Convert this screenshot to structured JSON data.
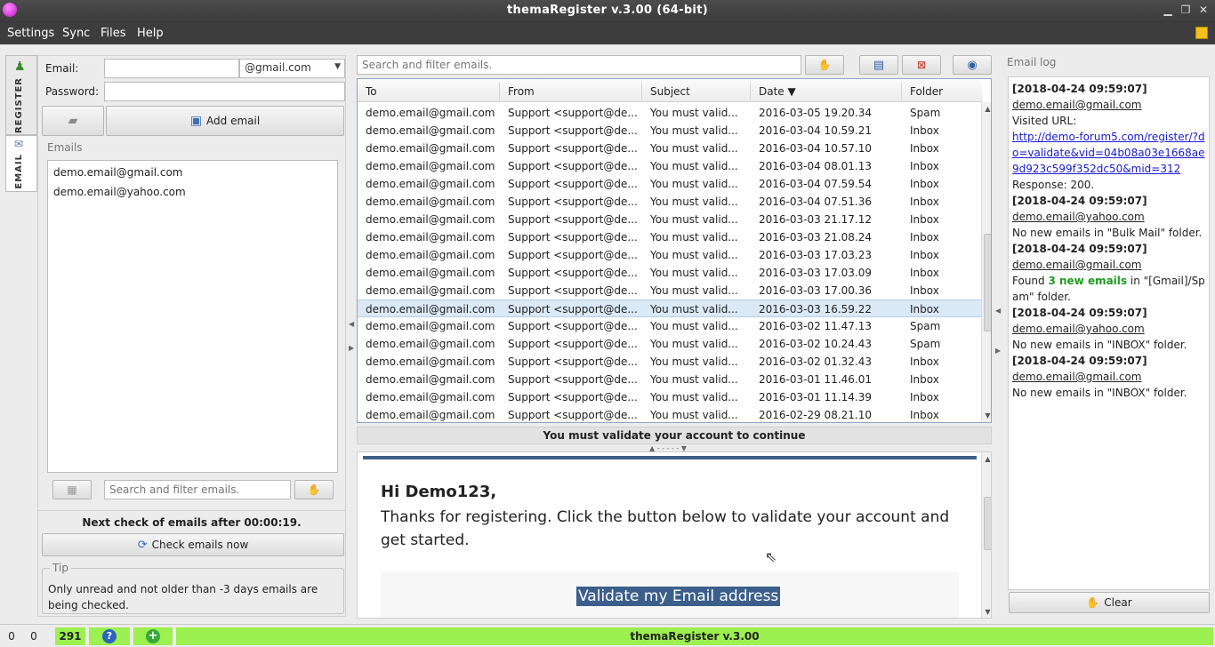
{
  "window": {
    "title": "themaRegister v.3.00  (64-bit)"
  },
  "menu": [
    "Settings",
    "Sync",
    "Files",
    "Help"
  ],
  "sidebar": {
    "tabs": [
      {
        "label": "REGISTER"
      },
      {
        "label": "EMAIL"
      }
    ]
  },
  "left": {
    "email_label": "Email:",
    "email_value": "",
    "domain": "@gmail.com",
    "password_label": "Password:",
    "password_value": "",
    "add_email": "Add email",
    "emails_group": "Emails",
    "emails": [
      "demo.email@gmail.com",
      "demo.email@yahoo.com"
    ],
    "search_placeholder": "Search and filter emails.",
    "next_check": "Next check of emails after 00:00:19.",
    "check_now": "Check emails now",
    "tip_label": "Tip",
    "tip_text": "Only unread and not older than -3 days emails are being checked."
  },
  "center": {
    "search_placeholder": "Search and filter emails.",
    "columns": [
      "To",
      "From",
      "Subject",
      "Date ▼",
      "Folder"
    ],
    "rows": [
      {
        "to": "demo.email@gmail.com",
        "from": "Support <support@de...",
        "subject": "You must valid...",
        "date": "2016-03-05 19.20.34",
        "folder": "Spam"
      },
      {
        "to": "demo.email@gmail.com",
        "from": "Support <support@de...",
        "subject": "You must valid...",
        "date": "2016-03-04 10.59.21",
        "folder": "Inbox"
      },
      {
        "to": "demo.email@gmail.com",
        "from": "Support <support@de...",
        "subject": "You must valid...",
        "date": "2016-03-04 10.57.10",
        "folder": "Inbox"
      },
      {
        "to": "demo.email@gmail.com",
        "from": "Support <support@de...",
        "subject": "You must valid...",
        "date": "2016-03-04 08.01.13",
        "folder": "Inbox"
      },
      {
        "to": "demo.email@gmail.com",
        "from": "Support <support@de...",
        "subject": "You must valid...",
        "date": "2016-03-04 07.59.54",
        "folder": "Inbox"
      },
      {
        "to": "demo.email@gmail.com",
        "from": "Support <support@de...",
        "subject": "You must valid...",
        "date": "2016-03-04 07.51.36",
        "folder": "Inbox"
      },
      {
        "to": "demo.email@gmail.com",
        "from": "Support <support@de...",
        "subject": "You must valid...",
        "date": "2016-03-03 21.17.12",
        "folder": "Inbox"
      },
      {
        "to": "demo.email@gmail.com",
        "from": "Support <support@de...",
        "subject": "You must valid...",
        "date": "2016-03-03 21.08.24",
        "folder": "Inbox"
      },
      {
        "to": "demo.email@gmail.com",
        "from": "Support <support@de...",
        "subject": "You must valid...",
        "date": "2016-03-03 17.03.23",
        "folder": "Inbox"
      },
      {
        "to": "demo.email@gmail.com",
        "from": "Support <support@de...",
        "subject": "You must valid...",
        "date": "2016-03-03 17.03.09",
        "folder": "Inbox"
      },
      {
        "to": "demo.email@gmail.com",
        "from": "Support <support@de...",
        "subject": "You must valid...",
        "date": "2016-03-03 17.00.36",
        "folder": "Inbox"
      },
      {
        "to": "demo.email@gmail.com",
        "from": "Support <support@de...",
        "subject": "You must valid...",
        "date": "2016-03-03 16.59.22",
        "folder": "Inbox"
      },
      {
        "to": "demo.email@gmail.com",
        "from": "Support <support@de...",
        "subject": "You must valid...",
        "date": "2016-03-02 11.47.13",
        "folder": "Spam"
      },
      {
        "to": "demo.email@gmail.com",
        "from": "Support <support@de...",
        "subject": "You must valid...",
        "date": "2016-03-02 10.24.43",
        "folder": "Spam"
      },
      {
        "to": "demo.email@gmail.com",
        "from": "Support <support@de...",
        "subject": "You must valid...",
        "date": "2016-03-02 01.32.43",
        "folder": "Inbox"
      },
      {
        "to": "demo.email@gmail.com",
        "from": "Support <support@de...",
        "subject": "You must valid...",
        "date": "2016-03-01 11.46.01",
        "folder": "Inbox"
      },
      {
        "to": "demo.email@gmail.com",
        "from": "Support <support@de...",
        "subject": "You must valid...",
        "date": "2016-03-01 11.14.39",
        "folder": "Inbox"
      },
      {
        "to": "demo.email@gmail.com",
        "from": "Support <support@de...",
        "subject": "You must valid...",
        "date": "2016-02-29 08.21.10",
        "folder": "Inbox"
      }
    ],
    "preview_subject": "You must validate your account to continue",
    "email_greeting": "Hi Demo123,",
    "email_body": "Thanks for registering. Click the button below to validate your account and get started.",
    "email_cta": "Validate my Email address"
  },
  "log": {
    "title": "Email log",
    "entries": [
      {
        "ts": "[2018-04-24 09:59:07]",
        "account": "demo.email@gmail.com",
        "lines": [
          "Visited URL:"
        ],
        "url": "http://demo-forum5.com/register/?do=validate&vid=04b08a03e1668ae9d923c599f352dc50&mid=312",
        "after": "Response: 200."
      },
      {
        "ts": "[2018-04-24 09:59:07]",
        "account": "demo.email@yahoo.com",
        "lines": [
          "No new emails in \"Bulk Mail\" folder."
        ]
      },
      {
        "ts": "[2018-04-24 09:59:07]",
        "account": "demo.email@gmail.com",
        "found_pre": "Found ",
        "found_bold": "3 new emails",
        "found_post": " in \"[Gmail]/Spam\" folder."
      },
      {
        "ts": "[2018-04-24 09:59:07]",
        "account": "demo.email@yahoo.com",
        "lines": [
          "No new emails in \"INBOX\" folder."
        ]
      },
      {
        "ts": "[2018-04-24 09:59:07]",
        "account": "demo.email@gmail.com",
        "lines": [
          "No new emails in \"INBOX\" folder."
        ]
      }
    ],
    "clear": "Clear"
  },
  "status": {
    "c1": "0",
    "c2": "0",
    "count": "291",
    "title": "themaRegister v.3.00"
  },
  "colors": {
    "accent_green": "#9cf04f",
    "link_blue": "#1a1ad0",
    "header_blue": "#3d5f8a",
    "cta_bg": "#3b5f8a"
  }
}
